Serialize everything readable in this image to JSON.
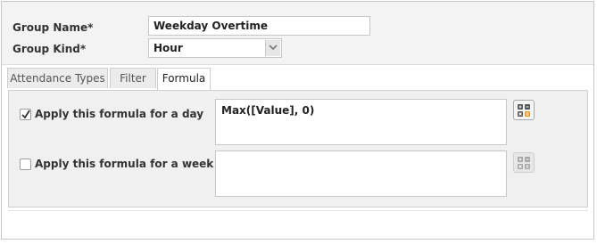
{
  "form": {
    "group_name_label": "Group Name*",
    "group_name_value": "Weekday Overtime",
    "group_kind_label": "Group Kind*",
    "group_kind_value": "Hour"
  },
  "tabs": [
    {
      "label": "Attendance Types",
      "active": false
    },
    {
      "label": "Filter",
      "active": false
    },
    {
      "label": "Formula",
      "active": true
    }
  ],
  "formula_panel": {
    "day": {
      "label": "Apply this formula for a day",
      "checked": true,
      "formula": "Max([Value], 0)"
    },
    "week": {
      "label": "Apply this formula for a week",
      "checked": false,
      "formula": ""
    }
  },
  "icons": {
    "calculator": "calculator-icon",
    "dropdown": "chevron-down-icon",
    "check": "checkmark-icon"
  },
  "colors": {
    "calc_accent": "#e89a2c",
    "calc_dark": "#555555"
  }
}
